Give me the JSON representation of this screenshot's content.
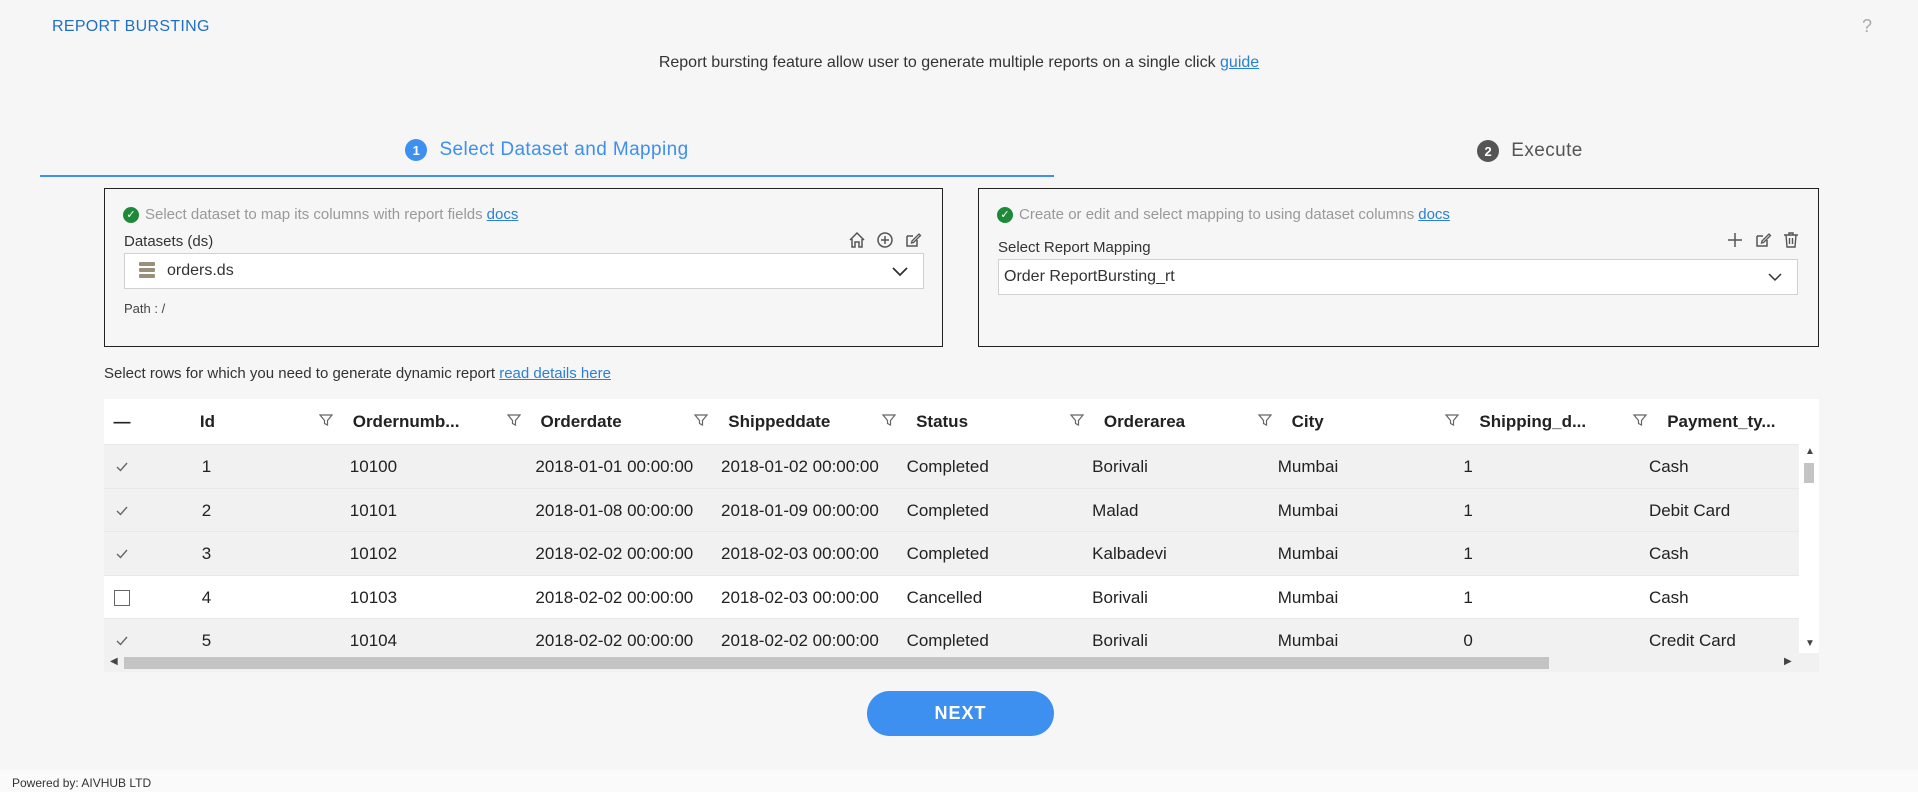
{
  "app": {
    "title": "REPORT BURSTING",
    "help_symbol": "?"
  },
  "intro": {
    "text": "Report bursting feature allow user to generate multiple reports on a single click",
    "link": "guide"
  },
  "stepper": {
    "steps": [
      {
        "number": "1",
        "label": "Select Dataset and Mapping",
        "active": true
      },
      {
        "number": "2",
        "label": "Execute",
        "active": false
      }
    ]
  },
  "dataset_panel": {
    "heading": "Select dataset to map its columns with report fields",
    "docs_link": "docs",
    "label": "Datasets (ds)",
    "selected": "orders.ds",
    "path": "Path : /",
    "icons": [
      "home-icon",
      "add-circle-icon",
      "edit-icon"
    ]
  },
  "mapping_panel": {
    "heading": "Create or edit and select mapping to using dataset columns",
    "docs_link": "docs",
    "label": "Select Report Mapping",
    "selected": "Order ReportBursting_rt",
    "icons": [
      "plus-icon",
      "edit-icon",
      "trash-icon"
    ]
  },
  "rows_hint": {
    "text": "Select rows for which you need to generate dynamic report",
    "link": "read details here"
  },
  "grid": {
    "select_all_symbol": "—",
    "columns": [
      "Id",
      "Ordernumb...",
      "Orderdate",
      "Shippeddate",
      "Status",
      "Orderarea",
      "City",
      "Shipping_d...",
      "Payment_ty..."
    ],
    "rows": [
      {
        "selected": true,
        "cells": [
          "1",
          "10100",
          "2018-01-01 00:00:00",
          "2018-01-02 00:00:00",
          "Completed",
          "Borivali",
          "Mumbai",
          "1",
          "Cash"
        ]
      },
      {
        "selected": true,
        "cells": [
          "2",
          "10101",
          "2018-01-08 00:00:00",
          "2018-01-09 00:00:00",
          "Completed",
          "Malad",
          "Mumbai",
          "1",
          "Debit Card"
        ]
      },
      {
        "selected": true,
        "cells": [
          "3",
          "10102",
          "2018-02-02 00:00:00",
          "2018-02-03 00:00:00",
          "Completed",
          "Kalbadevi",
          "Mumbai",
          "1",
          "Cash"
        ]
      },
      {
        "selected": false,
        "cells": [
          "4",
          "10103",
          "2018-02-02 00:00:00",
          "2018-02-03 00:00:00",
          "Cancelled",
          "Borivali",
          "Mumbai",
          "1",
          "Cash"
        ]
      },
      {
        "selected": true,
        "cells": [
          "5",
          "10104",
          "2018-02-02 00:00:00",
          "2018-02-02 00:00:00",
          "Completed",
          "Borivali",
          "Mumbai",
          "0",
          "Credit Card"
        ]
      }
    ]
  },
  "actions": {
    "next_label": "NEXT"
  },
  "footer": {
    "text": "Powered by: AIVHUB LTD"
  },
  "colors": {
    "accent": "#3d8ff0",
    "title": "#1f6fc5",
    "success": "#1c8a37"
  }
}
